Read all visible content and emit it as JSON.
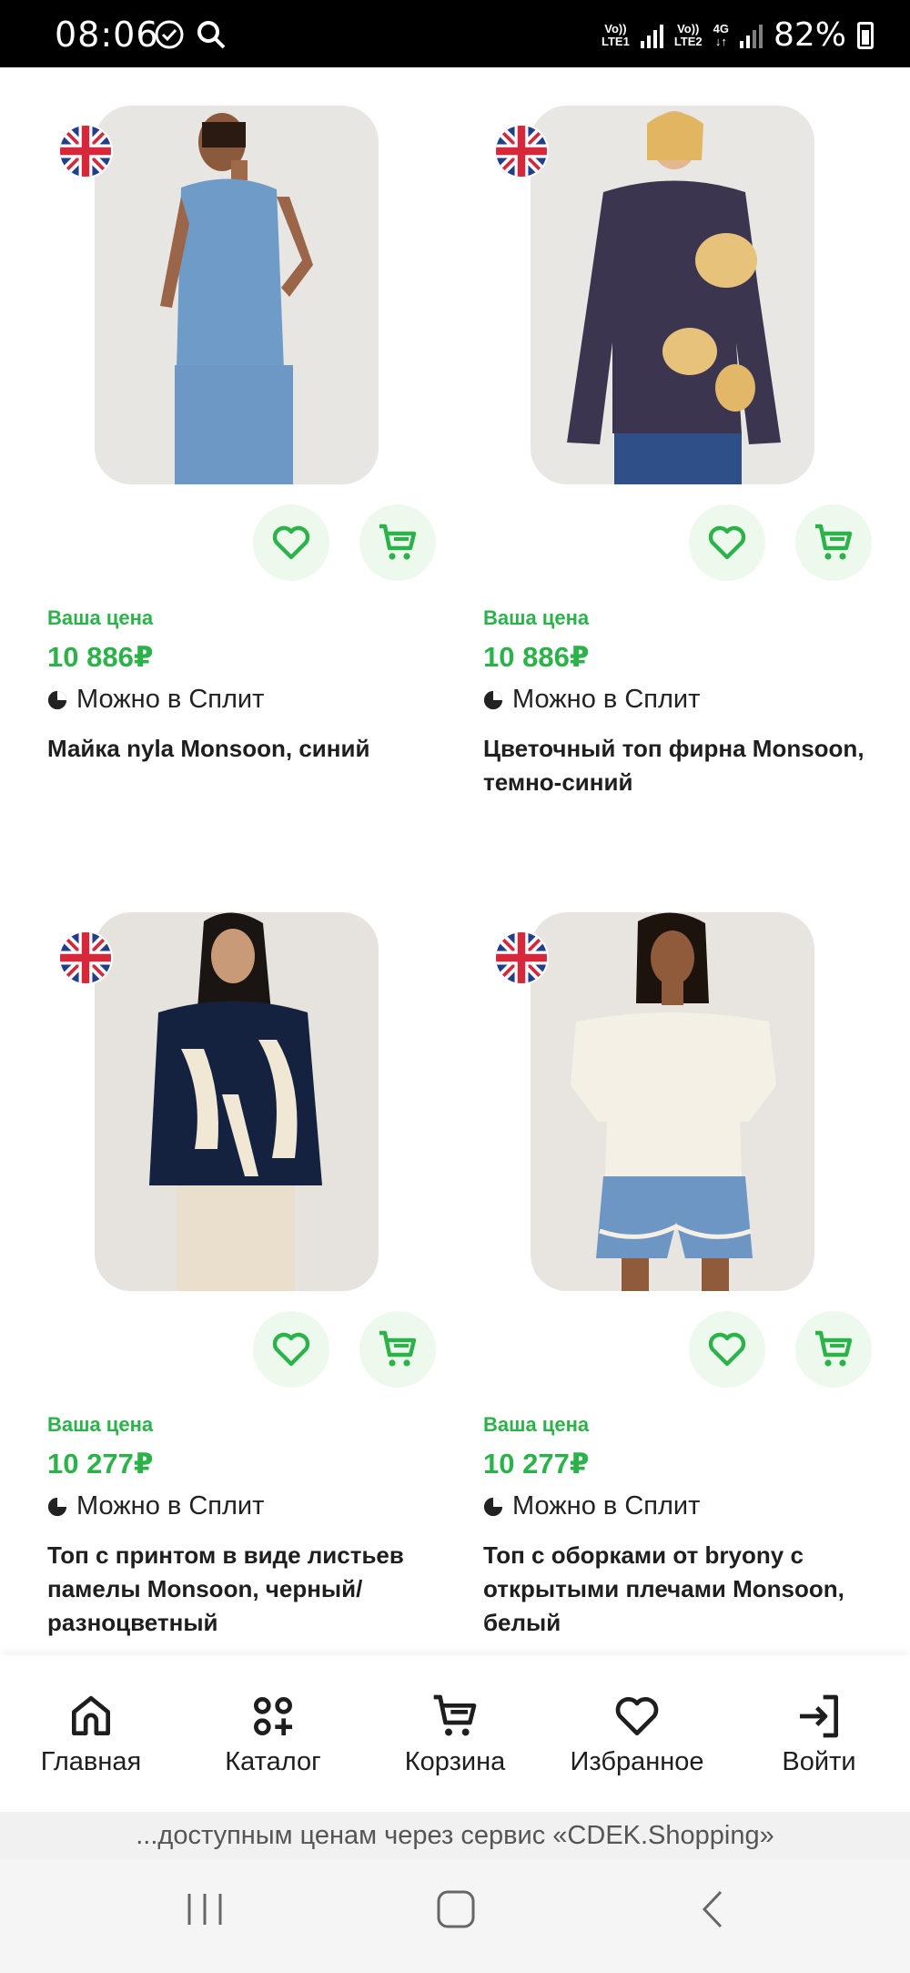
{
  "status_bar": {
    "time": "08:06",
    "sim1": {
      "line1": "Vo))",
      "line2": "LTE1"
    },
    "sim2": {
      "line1": "Vo))",
      "line2": "LTE2",
      "network": "4G"
    },
    "battery": "82%"
  },
  "products": [
    {
      "price_label": "Ваша цена",
      "price": "10 886₽",
      "split": "Можно в Сплит",
      "title": "Майка nyla Monsoon, синий"
    },
    {
      "price_label": "Ваша цена",
      "price": "10 886₽",
      "split": "Можно в Сплит",
      "title": "Цветочный топ фирна Monsoon, темно-синий"
    },
    {
      "price_label": "Ваша цена",
      "price": "10 277₽",
      "split": "Можно в Сплит",
      "title": "Топ с принтом в виде листьев памелы Monsoon, черный/разноцветный"
    },
    {
      "price_label": "Ваша цена",
      "price": "10 277₽",
      "split": "Можно в Сплит",
      "title": "Топ с оборками от bryony с открытыми плечами Monsoon, белый"
    }
  ],
  "bottom_nav": [
    {
      "label": "Главная",
      "icon": "home-icon"
    },
    {
      "label": "Каталог",
      "icon": "catalog-icon"
    },
    {
      "label": "Корзина",
      "icon": "cart-icon"
    },
    {
      "label": "Избранное",
      "icon": "heart-icon"
    },
    {
      "label": "Войти",
      "icon": "login-icon"
    }
  ],
  "banner": "...доступным ценам через сервис «CDEK.Shopping»",
  "colors": {
    "accent": "#2bb34a",
    "button_bg": "#eef9ee"
  }
}
